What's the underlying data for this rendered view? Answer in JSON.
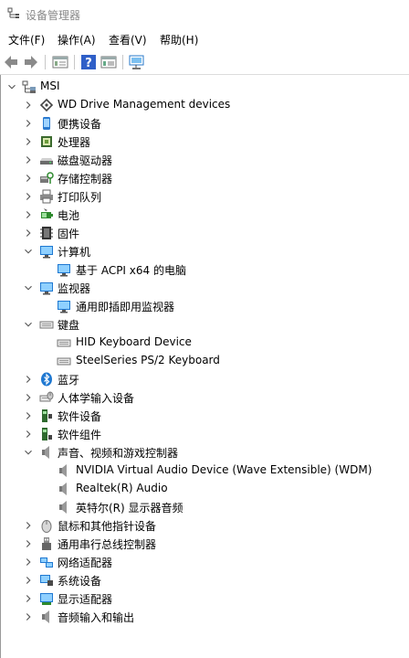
{
  "window": {
    "title": "设备管理器"
  },
  "menu": [
    "文件(F)",
    "操作(A)",
    "查看(V)",
    "帮助(H)"
  ],
  "toolbar": {
    "buttons": [
      "back-arrow-icon",
      "forward-arrow-icon",
      "properties-icon",
      "help-icon",
      "update-driver-icon",
      "scan-hardware-icon"
    ]
  },
  "tree": {
    "root": "MSI",
    "categories": [
      {
        "label": "WD Drive Management devices",
        "icon": "wd-device-icon",
        "expanded": false,
        "children": []
      },
      {
        "label": "便携设备",
        "icon": "portable-device-icon",
        "expanded": false,
        "children": []
      },
      {
        "label": "处理器",
        "icon": "processor-icon",
        "expanded": false,
        "children": []
      },
      {
        "label": "磁盘驱动器",
        "icon": "disk-drive-icon",
        "expanded": false,
        "children": []
      },
      {
        "label": "存储控制器",
        "icon": "storage-controller-icon",
        "expanded": false,
        "children": []
      },
      {
        "label": "打印队列",
        "icon": "printer-icon",
        "expanded": false,
        "children": []
      },
      {
        "label": "电池",
        "icon": "battery-icon",
        "expanded": false,
        "children": []
      },
      {
        "label": "固件",
        "icon": "firmware-icon",
        "expanded": false,
        "children": []
      },
      {
        "label": "计算机",
        "icon": "computer-icon",
        "expanded": true,
        "children": [
          "基于 ACPI x64 的电脑"
        ]
      },
      {
        "label": "监视器",
        "icon": "monitor-icon",
        "expanded": true,
        "children": [
          "通用即插即用监视器"
        ]
      },
      {
        "label": "键盘",
        "icon": "keyboard-icon",
        "expanded": true,
        "children": [
          "HID Keyboard Device",
          "SteelSeries PS/2 Keyboard"
        ]
      },
      {
        "label": "蓝牙",
        "icon": "bluetooth-icon",
        "expanded": false,
        "children": []
      },
      {
        "label": "人体学输入设备",
        "icon": "hid-icon",
        "expanded": false,
        "children": []
      },
      {
        "label": "软件设备",
        "icon": "software-device-icon",
        "expanded": false,
        "children": []
      },
      {
        "label": "软件组件",
        "icon": "software-component-icon",
        "expanded": false,
        "children": []
      },
      {
        "label": "声音、视频和游戏控制器",
        "icon": "speaker-icon",
        "expanded": true,
        "children": [
          "NVIDIA Virtual Audio Device (Wave Extensible) (WDM)",
          "Realtek(R) Audio",
          "英特尔(R) 显示器音频"
        ]
      },
      {
        "label": "鼠标和其他指针设备",
        "icon": "mouse-icon",
        "expanded": false,
        "children": []
      },
      {
        "label": "通用串行总线控制器",
        "icon": "usb-icon",
        "expanded": false,
        "children": []
      },
      {
        "label": "网络适配器",
        "icon": "network-adapter-icon",
        "expanded": false,
        "children": []
      },
      {
        "label": "系统设备",
        "icon": "system-device-icon",
        "expanded": false,
        "children": []
      },
      {
        "label": "显示适配器",
        "icon": "display-adapter-icon",
        "expanded": false,
        "children": []
      },
      {
        "label": "音频输入和输出",
        "icon": "audio-io-icon",
        "expanded": false,
        "children": []
      }
    ]
  }
}
